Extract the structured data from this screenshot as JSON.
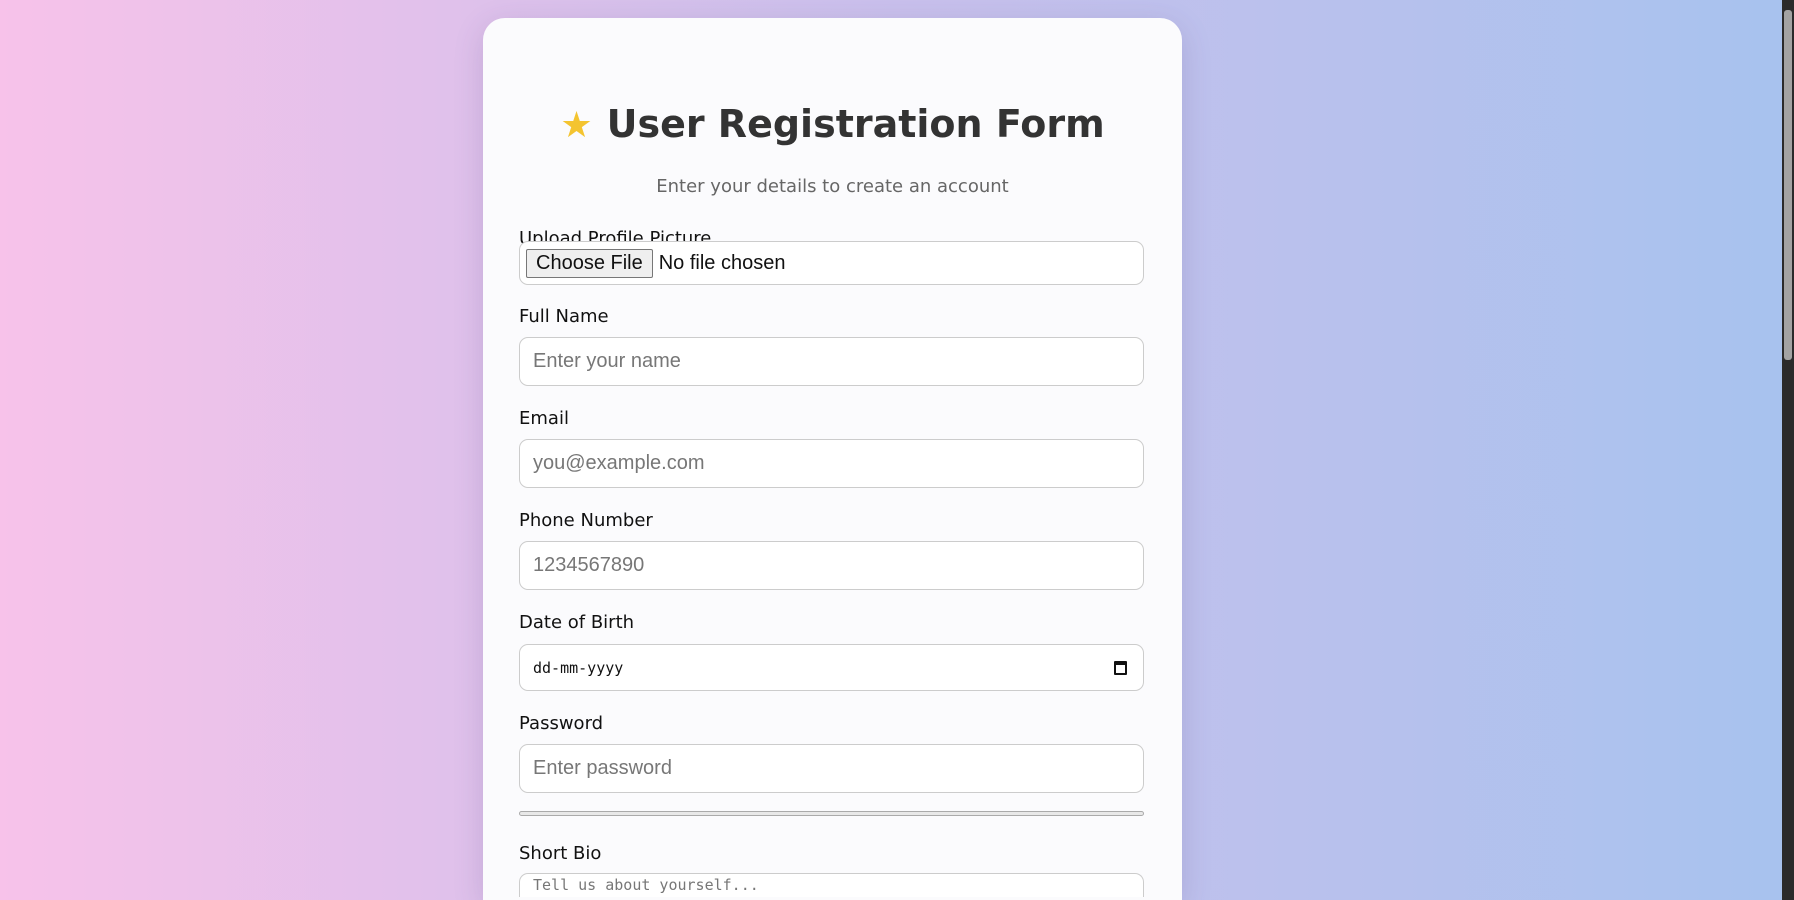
{
  "form": {
    "icon": "star-icon",
    "title": "User Registration Form",
    "subtitle": "Enter your details to create an account"
  },
  "fields": {
    "picture": {
      "label": "Upload Profile Picture",
      "button": "Choose File",
      "status": "No file chosen"
    },
    "name": {
      "label": "Full Name",
      "placeholder": "Enter your name"
    },
    "email": {
      "label": "Email",
      "placeholder": "you@example.com"
    },
    "phone": {
      "label": "Phone Number",
      "placeholder": "1234567890"
    },
    "dob": {
      "label": "Date of Birth",
      "placeholder": "dd-mm-yyyy"
    },
    "password": {
      "label": "Password",
      "placeholder": "Enter password",
      "strength": 0
    },
    "bio": {
      "label": "Short Bio",
      "placeholder": "Tell us about yourself..."
    }
  }
}
